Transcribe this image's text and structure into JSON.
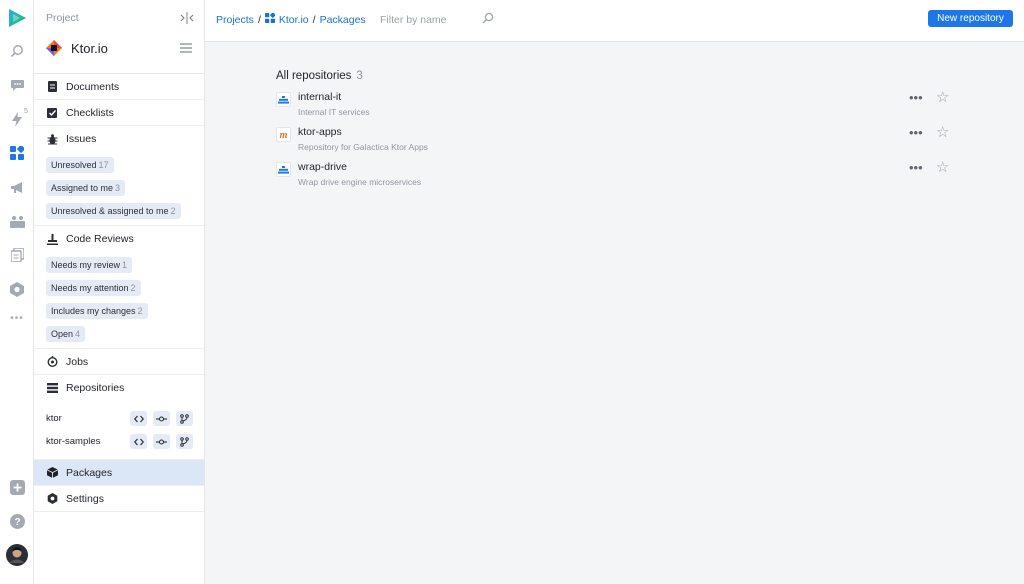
{
  "rail": {
    "icons": [
      "logo-icon",
      "search-icon",
      "chat-icon",
      "lightning-icon",
      "apps-icon",
      "megaphone-icon",
      "team-icon",
      "docs-icon",
      "hexagon-icon",
      "more-icon",
      "add-icon",
      "help-icon",
      "avatar"
    ],
    "lightning_badge": "5"
  },
  "sidebar": {
    "section_label": "Project",
    "project_name": "Ktor.io",
    "items": {
      "documents": "Documents",
      "checklists": "Checklists",
      "issues": "Issues",
      "code_reviews": "Code Reviews",
      "jobs": "Jobs",
      "repositories": "Repositories",
      "packages": "Packages",
      "settings": "Settings"
    },
    "issue_chips": [
      {
        "label": "Unresolved",
        "count": "17"
      },
      {
        "label": "Assigned to me",
        "count": "3"
      },
      {
        "label": "Unresolved & assigned to me",
        "count": "2"
      }
    ],
    "review_chips": [
      {
        "label": "Needs my review",
        "count": "1"
      },
      {
        "label": "Needs my attention",
        "count": "2"
      },
      {
        "label": "Includes my changes",
        "count": "2"
      },
      {
        "label": "Open",
        "count": "4"
      }
    ],
    "repos": [
      "ktor",
      "ktor-samples"
    ],
    "repo_buttons": [
      "<>",
      "-o-",
      "branch"
    ]
  },
  "topbar": {
    "crumb_projects": "Projects",
    "crumb_separator": "/",
    "crumb_project": "Ktor.io",
    "crumb_page": "Packages",
    "filter_placeholder": "Filter by name",
    "new_button": "New repository"
  },
  "main": {
    "title": "All repositories",
    "count": "3",
    "repositories": [
      {
        "name": "internal-it",
        "description": "Internal IT services",
        "icon": "container-icon"
      },
      {
        "name": "ktor-apps",
        "description": "Repository for Galactica Ktor Apps",
        "icon": "maven-icon"
      },
      {
        "name": "wrap-drive",
        "description": "Wrap drive engine microservices",
        "icon": "container-icon"
      }
    ],
    "more_glyph": "•••",
    "star_glyph": "☆"
  },
  "colors": {
    "accent": "#1e77e8",
    "active_nav": "#dbe6f7",
    "chip_bg": "#e4ebf6",
    "background": "#f4f5f7"
  }
}
